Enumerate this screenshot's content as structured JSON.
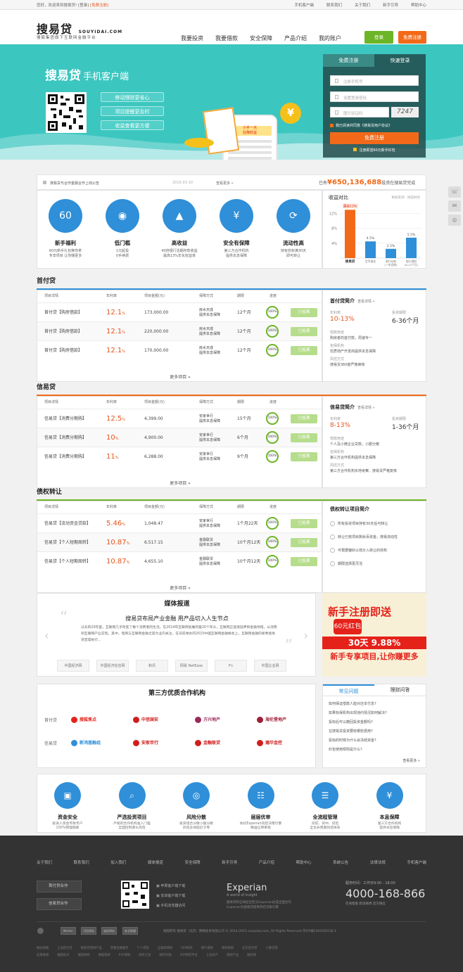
{
  "topbar": {
    "welcome": "您好，欢迎来到搜易贷!",
    "login": "[登录]",
    "register": "[免费注册]",
    "links": [
      "手机客户端",
      "联系我们",
      "关于我们",
      "新手引导",
      "帮助中心"
    ]
  },
  "header": {
    "logo": "搜易贷",
    "logo_en": "SOUYIDAI.COM",
    "logo_sub": "搜狐集团旗下互联网金融平台",
    "nav": [
      "我要投资",
      "我要借款",
      "安全保障",
      "产品介绍",
      "我的账户"
    ],
    "login_btn": "登录",
    "register_btn": "免费注册"
  },
  "banner": {
    "title": "搜易贷",
    "title_small": "手机客户端",
    "pills": [
      "移动理财更省心",
      "项目提醒更及时",
      "收益查看更方便"
    ],
    "coin": "¥",
    "phone_text": "小手一点\n狂赚收益"
  },
  "register_box": {
    "tabs": [
      "免费注册",
      "快速登录"
    ],
    "phone_placeholder": "注册手机号",
    "password_placeholder": "设置登录密码",
    "captcha_placeholder": "图片验证码",
    "captcha": "7247",
    "agree_prefix": "我已阅读并同意",
    "agree_link": "《搜易贷用户协议》",
    "submit": "免费注册",
    "note": "注册即送60元新手红包"
  },
  "notice": {
    "text": "搜易贷与合作金融合作上线公告",
    "date": "2015-03-10",
    "more": "查看更多 »",
    "stat_prefix": "已有",
    "stat_value": "¥650,136,688",
    "stat_suffix": "投资在搜易贷完成"
  },
  "features": [
    {
      "name": "新手福利",
      "desc": "60元新手礼包等你拿\n专享项目 让你赚更多",
      "icon": "60"
    },
    {
      "name": "低门槛",
      "desc": "1元起投\n0手续费",
      "icon": "piggy-bank-icon"
    },
    {
      "name": "高收益",
      "desc": "40倍银行活期存款收益\n最高13%年化收益率",
      "icon": "rocket-icon"
    },
    {
      "name": "安全有保障",
      "desc": "第三方合作机构\n提供本息保障",
      "icon": "shield-yen-icon"
    },
    {
      "name": "流动性高",
      "desc": "持有债权满30天\n即可转让",
      "icon": "refresh-icon"
    }
  ],
  "chart_data": {
    "type": "bar",
    "title": "收益对比",
    "subtitle": "数据来源：搜狐财经",
    "categories": [
      "搜易贷",
      "货币基金",
      "银行存款\n(一年定期)",
      "银行理财\n(6-12个月)"
    ],
    "values": [
      13,
      4.5,
      2.5,
      5.5
    ],
    "value_labels": [
      "最高13%",
      "4.5%",
      "2.5%",
      "5.5%"
    ],
    "yticks": [
      "12%",
      "8%",
      "4%"
    ],
    "ylim": [
      0,
      14
    ],
    "colors": [
      "#f26a19",
      "#2f8fd8",
      "#2f8fd8",
      "#2f8fd8"
    ]
  },
  "table_headers": [
    "项目详情",
    "年利率",
    "项目金额(元)",
    "保障方式",
    "期限",
    "进度"
  ],
  "sections": [
    {
      "title": "首付贷",
      "color": "#2f8fd8",
      "rows": [
        {
          "name": "首付贷【购房借款】",
          "rate": "12.1",
          "amount": "173,000.00",
          "guarantee": "房水天成\n提供本息保障",
          "term": "12个月",
          "progress": "100%",
          "action": "已投满"
        },
        {
          "name": "首付贷【购房借款】",
          "rate": "12.1",
          "amount": "220,000.00",
          "guarantee": "房水天成\n提供本息保障",
          "term": "12个月",
          "progress": "100%",
          "action": "已投满"
        },
        {
          "name": "首付贷【购房借款】",
          "rate": "12.1",
          "amount": "170,000.00",
          "guarantee": "房水天成\n提供本息保障",
          "term": "12个月",
          "progress": "100%",
          "action": "已投满"
        }
      ],
      "more": "更多项目 »",
      "intro": {
        "title": "首付贷简介",
        "more": "查看详情 »",
        "rate_label": "年利率",
        "rate_value": "10-13%",
        "term_label": "投资期限",
        "term_value": "6-36个月",
        "lines": [
          [
            "借款用途",
            "购房者的首付款，周速专一"
          ],
          [
            "担保机构",
            "优质地产开发商提供本息保障"
          ],
          [
            "风控方式",
            "搜易贷360度严格审核"
          ]
        ]
      }
    },
    {
      "title": "信易贷",
      "color": "#f26a19",
      "rows": [
        {
          "name": "信易贷【消费分期购】",
          "rate": "12.5",
          "amount": "4,399.00",
          "guarantee": "安家世行\n提供本息保障",
          "term": "15个月",
          "progress": "100%",
          "action": "已投满"
        },
        {
          "name": "信易贷【消费分期购】",
          "rate": "10",
          "amount": "4,900.00",
          "guarantee": "安家世行\n提供本息保障",
          "term": "6个月",
          "progress": "100%",
          "action": "已投满"
        },
        {
          "name": "信易贷【消费分期购】",
          "rate": "11",
          "amount": "6,288.00",
          "guarantee": "安家世行\n提供本息保障",
          "term": "9个月",
          "progress": "100%",
          "action": "已投满"
        }
      ],
      "more": "更多项目 »",
      "intro": {
        "title": "信易贷简介",
        "more": "查看详情 »",
        "rate_label": "年利率",
        "rate_value": "8-13%",
        "term_label": "投资期限",
        "term_value": "1-36个月",
        "lines": [
          [
            "借款用途",
            "个人及小微企业贷款，小额分散"
          ],
          [
            "担保机构",
            "第三方合作机构提供本息保障"
          ],
          [
            "风控方式",
            "第三方合作机构实地考察、搜易贷严格复核"
          ]
        ]
      }
    },
    {
      "title": "债权转让",
      "color": "#6cb526",
      "rows": [
        {
          "name": "信易贷【流动资金贷款】",
          "rate": "5.46",
          "amount": "1,048.47",
          "guarantee": "安家世行\n提供本息保障",
          "term": "1个月22天",
          "progress": "100%",
          "action": "已投满"
        },
        {
          "name": "信易贷【个人短期周转】",
          "rate": "10.87",
          "amount": "6,517.15",
          "guarantee": "金融联贷\n提供本息保障",
          "term": "10个月12天",
          "progress": "100%",
          "action": "已投满"
        },
        {
          "name": "信易贷【个人短期周转】",
          "rate": "10.87",
          "amount": "4,655.10",
          "guarantee": "金融联贷\n提供本息保障",
          "term": "10个月12天",
          "progress": "100%",
          "action": "已投满"
        }
      ],
      "more": "更多项目 »",
      "intro": {
        "title": "债权转让项目简介",
        "items": [
          "所有投资项目持有30天后可转让",
          "转让已核项目剩余百资金，搜易流动性",
          "可根据偏好以低价入转让的债权",
          "期限选择更灵活"
        ]
      }
    }
  ],
  "media": {
    "title": "媒体报道",
    "headline": "搜易贷布局产业金融 用产品切入人生节点",
    "body": "过去的20年里，互联网几乎改变了每个消费者的生活。在2014年互联网发展的第20个年头，互联网正逐渐延伸到金融领域，从消费到互联网产业实现。其中，电商与互联网金融尤其为业内关注，在日前举办的2015中国互联网金融峰会上，互联网金融的新秀搜易贷首席执行...",
    "logos": [
      "中国经济网",
      "中国经济信息网",
      "和讯",
      "网易 NetEase",
      "Fn",
      "中国企业网"
    ]
  },
  "promo": {
    "line1": "新手注册即送",
    "line2": "60元红包",
    "line3": "30天 9.88%",
    "line4": "新手专享项目,让你赚更多"
  },
  "partners": {
    "title": "第三方优质合作机构",
    "rows": [
      {
        "label": "首付贷",
        "logos": [
          [
            "搜狐焦点",
            "#e5221a"
          ],
          [
            "中信国安",
            "#d11d1d"
          ],
          [
            "方兴地产",
            "#9a2a5b"
          ],
          [
            "海伦堡地产",
            "#a02038"
          ]
        ]
      },
      {
        "label": "信易贷",
        "logos": [
          [
            "新鸿基融组",
            "#2f8fd8"
          ],
          [
            "安家世行",
            "#d11d1d"
          ],
          [
            "金融联贷",
            "#d11d1d"
          ],
          [
            "瀚华金控",
            "#d11d1d"
          ]
        ]
      }
    ]
  },
  "faq": {
    "tabs": [
      "常见问题",
      "理财问答"
    ],
    "items": [
      "如何保证借款人能对还本付息?",
      "如果标保机构出现违约情况如何解决?",
      "投标后可以撤回投资金额吗?",
      "在搜易贷投资要收哪些费用?",
      "投标的时候为什么会冻结资金?",
      "红包使用规则是什么?"
    ],
    "more": "查看更多 »"
  },
  "guarantees": [
    {
      "name": "资金安全",
      "desc": "投资人资金专款专户\n100%物理隔离"
    },
    {
      "name": "严选投资项目",
      "desc": "严格的合作机构准入门槛\n全面控制源头风险"
    },
    {
      "name": "风险分散",
      "desc": "投资组合分散小额分散\n风险总体趋近于零"
    },
    {
      "name": "层层优审",
      "desc": "依托Experian风控决策引擎\n精准信用审核"
    },
    {
      "name": "全流程管理",
      "desc": "贷前、贷中、贷后\n全生命周期风控体系"
    },
    {
      "name": "本息保障",
      "desc": "第三方合作机构\n提供本息保障"
    }
  ],
  "footer": {
    "links": [
      "关于我们",
      "联系我们",
      "加入我们",
      "媒体报道",
      "安全保障",
      "新手引导",
      "产品介绍",
      "帮助中心",
      "系统公告",
      "法律法规",
      "手机客户端"
    ],
    "buttons": [
      "首付贷合作",
      "信易贷合作"
    ],
    "downloads": [
      "苹果客户端下载",
      "安卓客户端下载",
      "手机浏览器访问"
    ],
    "experian": "Experian",
    "experian_tag": "A world of insight",
    "experian_note": "搜易贷和全球征信巨头Experian达成全面合作\nExperian为搜易贷提供风控决策引擎",
    "hotline_label": "服务时间：工作日9:00 - 18:00",
    "hotline": "4000-168-866",
    "follow": "在线客服   新浪微博   官方微信",
    "copyright": "搜狐所有 搜易贷（北京）网络技术有限公司 © 2014-2015 souyidai.com, All Rights Reserved 京ICP备14032951号-1",
    "badges": [
      "Norton",
      "可信网站",
      "诚信网站",
      "安全联盟"
    ],
    "links2": [
      "网站地图",
      "上海首付贷",
      "搜易贷理财产品",
      "普惠金融服务",
      "个人贷款",
      "互联网理财",
      "P2P网贷",
      "银行理财",
      "理财规划",
      "北京首付贷",
      "小额贷款"
    ],
    "links3": [
      "友情链接",
      "搜狐焦点",
      "搜狐财经",
      "搜狐理财",
      "P2P理财",
      "网贷之家",
      "网贷天眼",
      "P2P网贷平台",
      "上海房产",
      "理财产品",
      "融资网"
    ]
  },
  "side": [
    "headset-icon",
    "wechat-icon",
    "weibo-icon"
  ]
}
